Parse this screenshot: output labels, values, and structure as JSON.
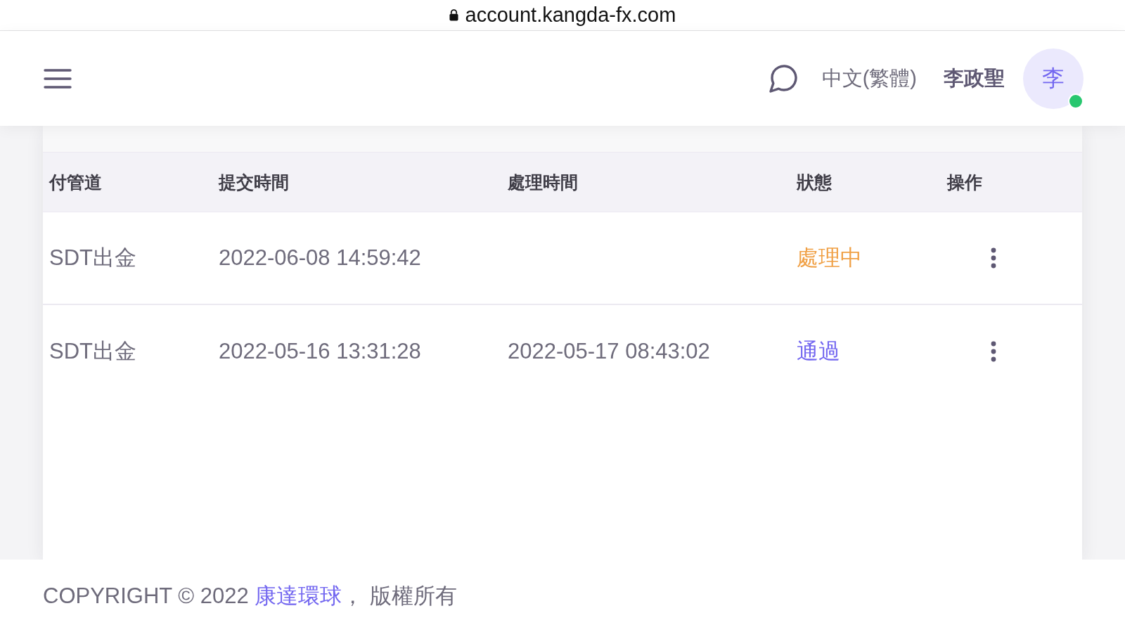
{
  "browser": {
    "url": "account.kangda-fx.com"
  },
  "header": {
    "language": "中文(繁體)",
    "user": {
      "name": "李政聖",
      "initial": "李",
      "online": true
    }
  },
  "table": {
    "columns": [
      "付管道",
      "提交時間",
      "處理時間",
      "狀態",
      "操作"
    ],
    "rows": [
      {
        "channel": "SDT出金",
        "submitted": "2022-06-08 14:59:42",
        "status": {
          "text": "處理中",
          "color": "#f0a045"
        }
      },
      {
        "channel": "SDT出金",
        "submitted": "2022-05-16 13:31:28",
        "processed": "2022-05-17 08:43:02",
        "status": {
          "text": "通過",
          "color": "#7367f0"
        }
      }
    ]
  },
  "footer": {
    "prefix": "COPYRIGHT © 2022",
    "link": "康達環球",
    "suffix": "， 版權所有"
  }
}
